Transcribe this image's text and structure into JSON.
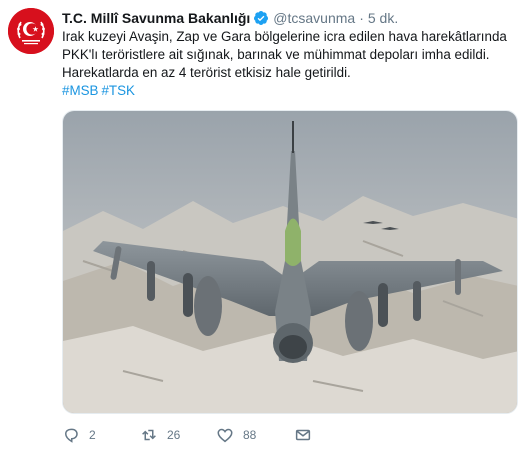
{
  "tweet": {
    "display_name": "T.C. Millî Savunma Bakanlığı",
    "handle": "@tcsavunma",
    "separator": "·",
    "time": "5 dk.",
    "text": "Irak kuzeyi Avaşin, Zap ve Gara bölgelerine icra edilen hava harekâtlarında PKK'lı teröristlere ait sığınak, barınak ve mühimmat depoları imha edildi. Harekatlarda en az 4 terörist etkisiz hale getirildi.",
    "hashtags": [
      "#MSB",
      "#TSK"
    ],
    "media_description_icon": "fighter-jet-photo",
    "actions": {
      "reply_count": "2",
      "retweet_count": "26",
      "like_count": "88"
    }
  },
  "colors": {
    "link": "#1b95e0",
    "muted": "#657786",
    "avatar_bg": "#d7101d",
    "verified": "#1da1f2"
  }
}
